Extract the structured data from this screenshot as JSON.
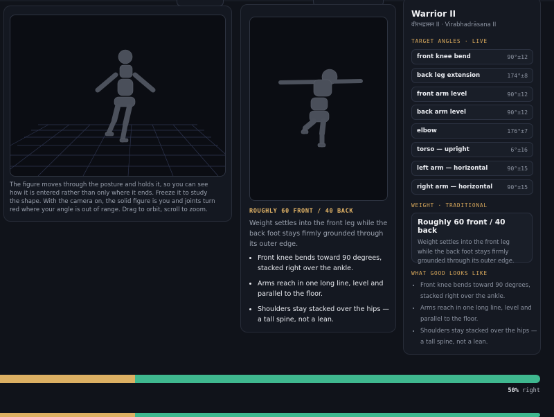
{
  "card1": {
    "caption": "The figure moves through the posture and holds it, so you can see how it is entered rather than only where it ends. Freeze it to study the shape. With the camera on, the solid figure is you and joints turn red where your angle is out of range. Drag to orbit, scroll to zoom."
  },
  "card2": {
    "weight_kicker": "ROUGHLY 60 FRONT / 40 BACK",
    "weight_desc": "Weight settles into the front leg while the back foot stays firmly grounded through its outer edge.",
    "cues": [
      "Front knee bends toward 90 degrees, stacked right over the ankle.",
      "Arms reach in one long line, level and parallel to the floor.",
      "Shoulders stay stacked over the hips — a tall spine, not a lean."
    ]
  },
  "side": {
    "title": "Warrior II",
    "subtitle": "वीरभद्रासन II · Virabhadrāsana II",
    "angles_label": "TARGET ANGLES · LIVE",
    "angles": [
      {
        "name": "front knee bend",
        "tol": "90°±12"
      },
      {
        "name": "back leg extension",
        "tol": "174°±8"
      },
      {
        "name": "front arm level",
        "tol": "90°±12"
      },
      {
        "name": "back arm level",
        "tol": "90°±12"
      },
      {
        "name": "elbow",
        "tol": "176°±7"
      },
      {
        "name": "torso — upright",
        "tol": "6°±16"
      },
      {
        "name": "left arm — horizontal",
        "tol": "90°±15"
      },
      {
        "name": "right arm — horizontal",
        "tol": "90°±15"
      }
    ],
    "weight_label": "WEIGHT · TRADITIONAL",
    "weight_title": "Roughly 60 front / 40 back",
    "weight_desc": "Weight settles into the front leg while the back foot stays firmly grounded through its outer edge.",
    "cues_label": "WHAT GOOD LOOKS LIKE",
    "cues": [
      "Front knee bends toward 90 degrees, stacked right over the ankle.",
      "Arms reach in one long line, level and parallel to the floor.",
      "Shoulders stay stacked over the hips — a tall spine, not a lean."
    ]
  },
  "balance": {
    "left_fraction": 0.25,
    "right_fraction": 0.75,
    "percent": "50%",
    "side": "right",
    "color_left": "#dcb063",
    "color_right": "#3fb88f"
  }
}
